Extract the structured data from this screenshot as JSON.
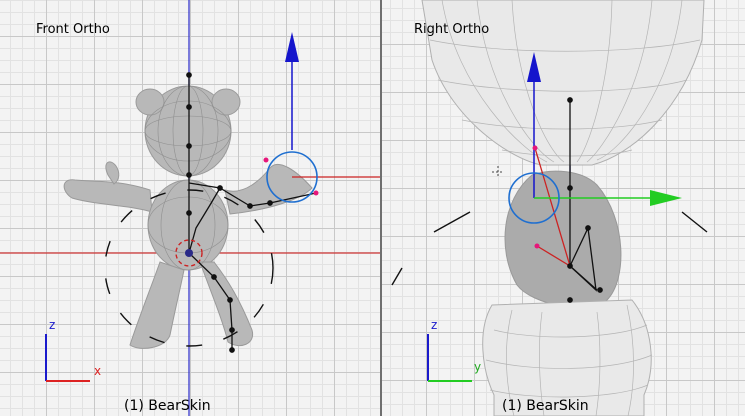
{
  "viewports": {
    "front": {
      "title": "Front Ortho",
      "object_label": "(1) BearSkin",
      "axis_vertical": "z",
      "axis_horizontal": "x"
    },
    "right": {
      "title": "Right Ortho",
      "object_label": "(1) BearSkin",
      "axis_vertical": "z",
      "axis_horizontal": "y"
    }
  },
  "icons": [
    "translate-arrow-z-icon",
    "translate-arrow-y-icon",
    "rotate-circle-icon",
    "axis-gizmo-icon"
  ],
  "colors": {
    "grid_major": "#c8c8c8",
    "grid_minor": "#e2e2e2",
    "background": "#f3f3f3",
    "z_axis": "#0000cc",
    "x_axis": "#cc2222",
    "y_axis": "#22cc22",
    "manipulator_circle": "#1f6fd0",
    "mesh": "#a8a8a8",
    "bones": "#111111"
  }
}
